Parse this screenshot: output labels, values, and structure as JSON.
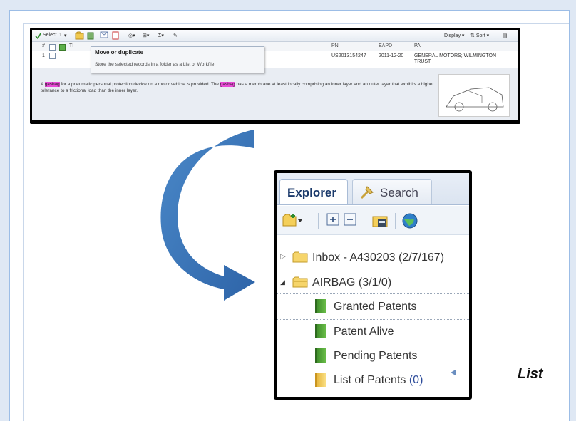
{
  "toolbar": {
    "select_label": "Select",
    "select_count": "1",
    "display_label": "Display",
    "sort_label": "Sort"
  },
  "columns": {
    "num": "#",
    "ti": "TI",
    "pn": "PN",
    "eapd": "EAPD",
    "pa": "PA"
  },
  "record": {
    "num": "1",
    "pn": "US2013154247",
    "eapd": "2011-12-20",
    "pa_line1": "GENERAL MOTORS; WILMINGTON",
    "pa_line2": "TRUST",
    "abstract_parts": [
      "A ",
      "gasbag",
      " for a pneumatic personal protection device on a motor vehicle is provided. The ",
      "gasbag",
      " has a membrane at least locally comprising an inner layer and an outer layer that exhibits a higher tolerance to a frictional load than the inner layer."
    ]
  },
  "tooltip": {
    "title": "Move or duplicate",
    "description": "Store the selected records in a folder as a List or Workfile"
  },
  "explorer": {
    "tab_explorer": "Explorer",
    "tab_search": "Search",
    "tree": [
      {
        "label": "Inbox - A430203 (2/7/167)",
        "type": "folder",
        "expanded": false
      },
      {
        "label": "AIRBAG (3/1/0)",
        "type": "folder",
        "expanded": true
      },
      {
        "label": "Granted Patents",
        "type": "workfile"
      },
      {
        "label": "Patent Alive",
        "type": "workfile"
      },
      {
        "label": "Pending Patents",
        "type": "workfile"
      },
      {
        "label": "List of Patents",
        "count": "(0)",
        "type": "list"
      }
    ]
  },
  "annotation": {
    "label": "List"
  },
  "colors": {
    "highlight": "#e84ad6",
    "frame": "#9cbde6",
    "arrow": "#3f7fc4"
  }
}
